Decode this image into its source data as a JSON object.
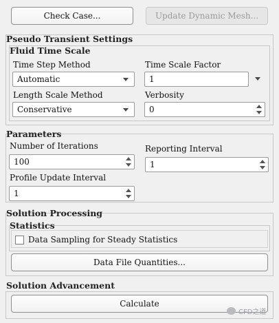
{
  "top_buttons": {
    "check_case": "Check Case...",
    "update_dynamic_mesh": "Update Dynamic Mesh..."
  },
  "pseudo_transient": {
    "title": "Pseudo Transient Settings",
    "fluid_time_scale": {
      "title": "Fluid Time Scale",
      "time_step_method_label": "Time Step Method",
      "time_step_method_value": "Automatic",
      "time_scale_factor_label": "Time Scale Factor",
      "time_scale_factor_value": "1",
      "length_scale_method_label": "Length Scale Method",
      "length_scale_method_value": "Conservative",
      "verbosity_label": "Verbosity",
      "verbosity_value": "0"
    }
  },
  "parameters": {
    "title": "Parameters",
    "number_of_iterations_label": "Number of Iterations",
    "number_of_iterations_value": "100",
    "reporting_interval_label": "Reporting Interval",
    "reporting_interval_value": "1",
    "profile_update_interval_label": "Profile Update Interval",
    "profile_update_interval_value": "1"
  },
  "solution_processing": {
    "title": "Solution Processing",
    "statistics": {
      "title": "Statistics",
      "data_sampling_label": "Data Sampling for Steady Statistics",
      "data_sampling_checked": false
    },
    "data_file_quantities": "Data File Quantities..."
  },
  "solution_advancement": {
    "title": "Solution Advancement",
    "calculate": "Calculate"
  },
  "watermark": {
    "text": "CFD之道"
  }
}
